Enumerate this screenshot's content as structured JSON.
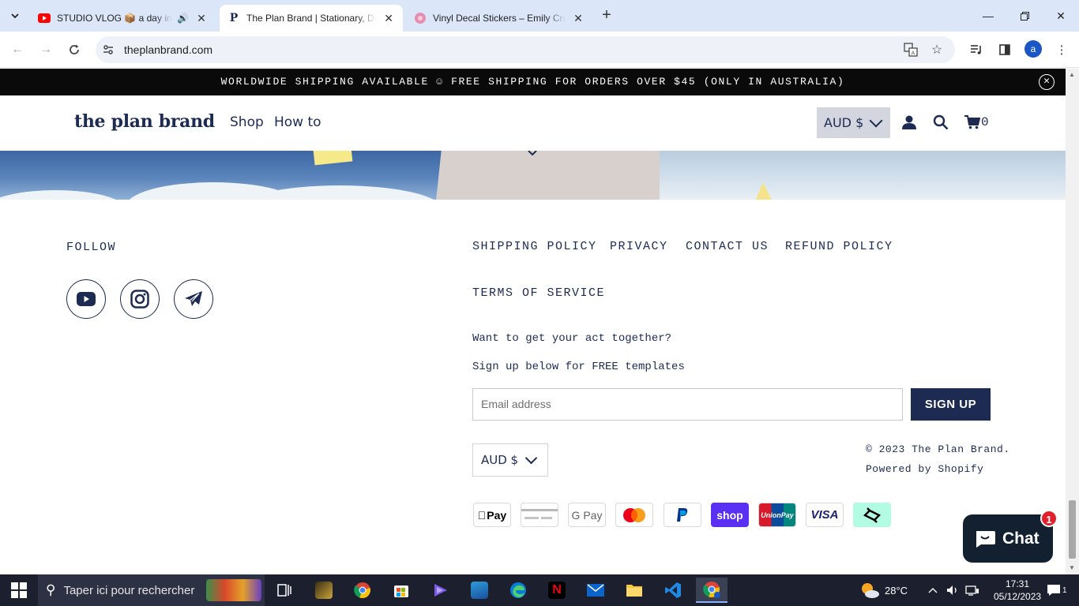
{
  "browser": {
    "tabs": [
      {
        "title": "STUDIO VLOG 📦 a day in a",
        "favicon": "youtube-icon",
        "audio": true
      },
      {
        "title": "The Plan Brand | Stationary, Dia",
        "favicon": "plan-brand-icon",
        "active": true
      },
      {
        "title": "Vinyl Decal Stickers – Emily Cro",
        "favicon": "sticker-icon"
      }
    ],
    "url": "theplanbrand.com",
    "profile_initial": "a"
  },
  "announcement": {
    "text": "WORLDWIDE SHIPPING AVAILABLE ☺ FREE SHIPPING FOR ORDERS OVER $45 (ONLY IN AUSTRALIA)"
  },
  "header": {
    "logo": "the plan brand",
    "nav": [
      "Shop",
      "How to"
    ],
    "currency": "AUD $",
    "cart_count": "0"
  },
  "footer": {
    "follow_label": "FOLLOW",
    "social": [
      "youtube-icon",
      "instagram-icon",
      "telegram-icon"
    ],
    "links": [
      "SHIPPING POLICY",
      "PRIVACY",
      "CONTACT US",
      "REFUND POLICY",
      "TERMS OF SERVICE"
    ],
    "promo_line1": "Want to get your act together?",
    "promo_line2": "Sign up below for FREE templates",
    "email_placeholder": "Email address",
    "signup_label": "SIGN UP",
    "currency": "AUD $",
    "copyright": "© 2023 The Plan Brand.",
    "powered": "Powered by Shopify",
    "payments": [
      "Apple Pay",
      "Generic card",
      "Google Pay",
      "Mastercard",
      "PayPal",
      "Shop Pay",
      "Union Pay",
      "Visa",
      "Afterpay"
    ]
  },
  "payment_labels": {
    "apple": "Pay",
    "google": "G Pay",
    "shop": "shop",
    "union": "UnionPay",
    "visa": "VISA"
  },
  "chat": {
    "label": "Chat",
    "badge": "1"
  },
  "taskbar": {
    "search_placeholder": "Taper ici pour rechercher",
    "weather": "28°C",
    "time": "17:31",
    "date": "05/12/2023",
    "notif_count": "1"
  },
  "colors": {
    "brand_navy": "#1d2b53",
    "announcement_bg": "#0a0a0a",
    "tab_strip": "#dbe6f8"
  }
}
